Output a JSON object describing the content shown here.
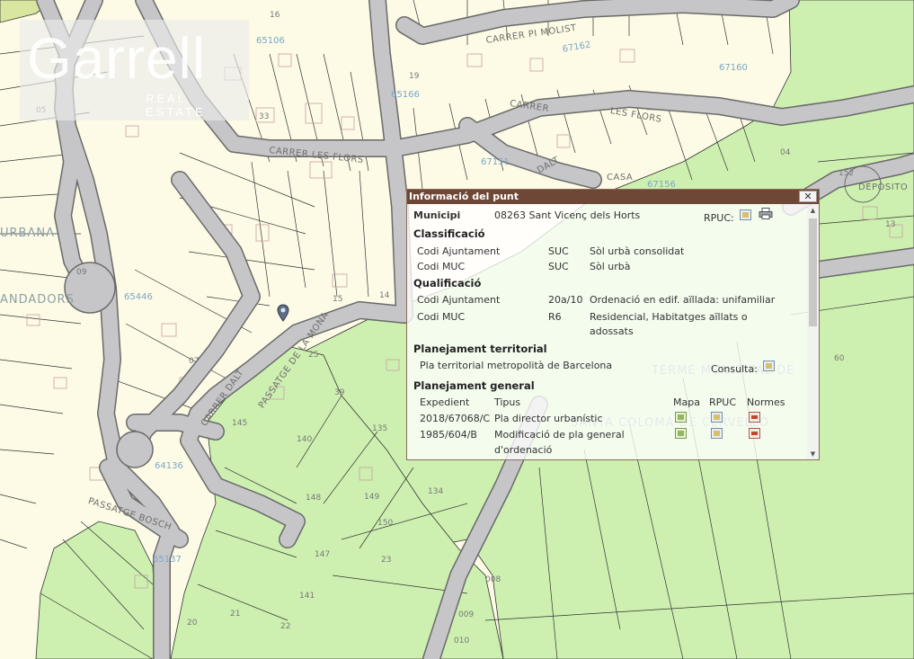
{
  "logo": {
    "name": "Garrell",
    "subtitle": "REAL ESTATE"
  },
  "map_labels": [
    {
      "text": "CARRER PI MOLIST",
      "cls": "street"
    },
    {
      "text": "CARRER",
      "cls": "street"
    },
    {
      "text": "LES FLORS",
      "cls": "street"
    },
    {
      "text": "CARRER LES FLORS",
      "cls": "street"
    },
    {
      "text": "DALT",
      "cls": "street"
    },
    {
      "text": "CASA",
      "cls": "street"
    },
    {
      "text": "URBANA",
      "cls": "big"
    },
    {
      "text": "ANDADORS",
      "cls": "big"
    },
    {
      "text": "TERME MUNICIPAL DE",
      "cls": "big"
    },
    {
      "text": "SANTA COLOMA DE CERVELLÓ",
      "cls": "big"
    },
    {
      "text": "CARRER DALT",
      "cls": "street"
    },
    {
      "text": "PASSATGE BOSCH",
      "cls": "street"
    },
    {
      "text": "PASSATGE DE LA MONA",
      "cls": "street"
    },
    {
      "text": "DEPÒSITO",
      "cls": "street"
    },
    {
      "text": "65166",
      "cls": "blue"
    },
    {
      "text": "65106",
      "cls": "blue"
    },
    {
      "text": "67162",
      "cls": "blue"
    },
    {
      "text": "67160",
      "cls": "blue"
    },
    {
      "text": "67156",
      "cls": "blue"
    },
    {
      "text": "67151",
      "cls": "blue"
    },
    {
      "text": "65446",
      "cls": "blue"
    },
    {
      "text": "64136",
      "cls": "blue"
    },
    {
      "text": "65137",
      "cls": "blue"
    },
    {
      "text": "16",
      "cls": "num"
    },
    {
      "text": "19",
      "cls": "num"
    },
    {
      "text": "33",
      "cls": "num"
    },
    {
      "text": "15",
      "cls": "num"
    },
    {
      "text": "05",
      "cls": "num"
    },
    {
      "text": "07",
      "cls": "num"
    },
    {
      "text": "14",
      "cls": "num"
    },
    {
      "text": "25",
      "cls": "num"
    },
    {
      "text": "39",
      "cls": "num"
    },
    {
      "text": "145",
      "cls": "num"
    },
    {
      "text": "140",
      "cls": "num"
    },
    {
      "text": "135",
      "cls": "num"
    },
    {
      "text": "134",
      "cls": "num"
    },
    {
      "text": "148",
      "cls": "num"
    },
    {
      "text": "149",
      "cls": "num"
    },
    {
      "text": "150",
      "cls": "num"
    },
    {
      "text": "147",
      "cls": "num"
    },
    {
      "text": "141",
      "cls": "num"
    },
    {
      "text": "23",
      "cls": "num"
    },
    {
      "text": "22",
      "cls": "num"
    },
    {
      "text": "21",
      "cls": "num"
    },
    {
      "text": "20",
      "cls": "num"
    },
    {
      "text": "152",
      "cls": "num"
    },
    {
      "text": "60",
      "cls": "num"
    },
    {
      "text": "13",
      "cls": "num"
    },
    {
      "text": "09",
      "cls": "num"
    },
    {
      "text": "04",
      "cls": "num"
    },
    {
      "text": "008",
      "cls": "num"
    },
    {
      "text": "009",
      "cls": "num"
    },
    {
      "text": "010",
      "cls": "num"
    }
  ],
  "popup": {
    "title": "Informació del punt",
    "close_label": "✕",
    "municipi_label": "Municipi",
    "municipi_value": "08263 Sant Vicenç dels Horts",
    "rpuc_label": "RPUC:",
    "classificacio_heading": "Classificació",
    "classificacio": [
      {
        "label": "Codi Ajuntament",
        "code": "SUC",
        "desc": "Sòl urbà consolidat"
      },
      {
        "label": "Codi MUC",
        "code": "SUC",
        "desc": "Sòl urbà"
      }
    ],
    "qualificacio_heading": "Qualificació",
    "qualificacio": [
      {
        "label": "Codi Ajuntament",
        "code": "20a/10",
        "desc": "Ordenació en edif. aïllada: unifamiliar"
      },
      {
        "label": "Codi MUC",
        "code": "R6",
        "desc": "Residencial, Habitatges aïllats o",
        "desc2": "adossats"
      }
    ],
    "territorial_heading": "Planejament territorial",
    "territorial_value": "Pla territorial metropolità de Barcelona",
    "consulta_label": "Consulta:",
    "general_heading": "Planejament general",
    "table_headers": {
      "expedient": "Expedient",
      "tipus": "Tipus",
      "mapa": "Mapa",
      "rpuc": "RPUC",
      "normes": "Normes"
    },
    "general_rows": [
      {
        "expedient": "2018/67068/C",
        "tipus": "Pla director urbanístic"
      },
      {
        "expedient": "1985/604/B",
        "tipus": "Modificació de pla general",
        "tipus2": "d'ordenació"
      }
    ]
  },
  "colors": {
    "urban": "#fdfbe6",
    "green": "#cdf0b0",
    "road": "#c6c6c8",
    "road_edge": "#6a6a6a",
    "titlebar": "#6e4737"
  }
}
